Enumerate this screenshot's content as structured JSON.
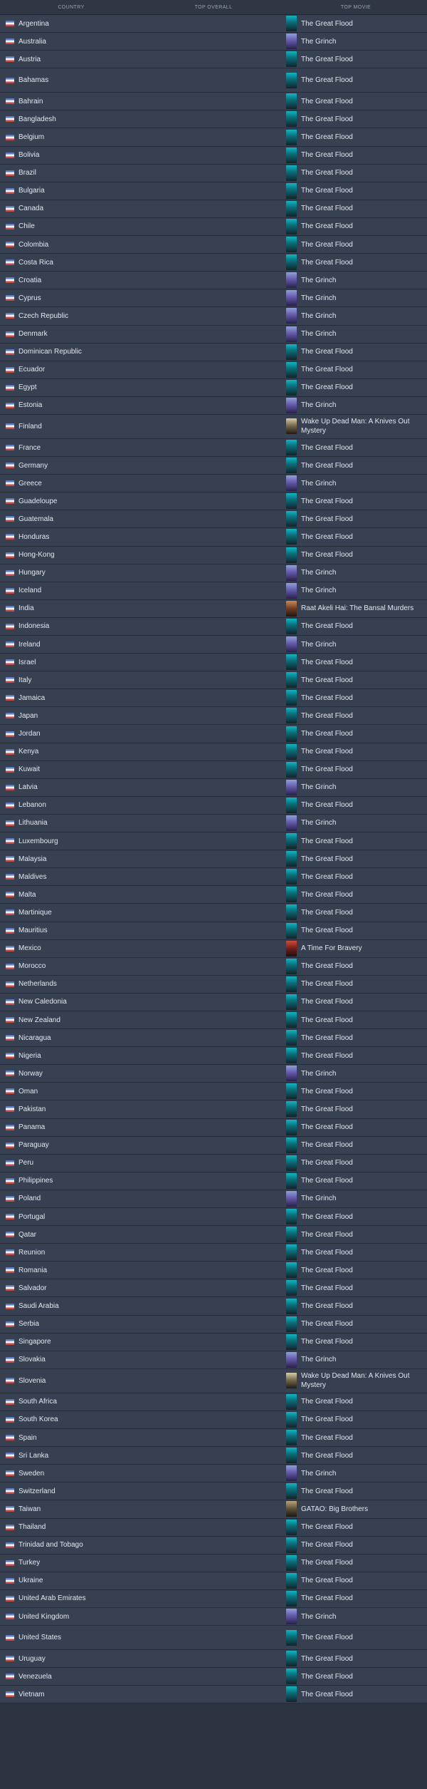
{
  "header": {
    "country": "COUNTRY",
    "overall": "TOP OVERALL",
    "movie": "TOP MOVIE"
  },
  "rows": [
    {
      "country": "Argentina",
      "movie": "The Great Flood",
      "poster": "flood"
    },
    {
      "country": "Australia",
      "movie": "The Grinch",
      "poster": "grinch"
    },
    {
      "country": "Austria",
      "movie": "The Great Flood",
      "poster": "flood"
    },
    {
      "country": "Bahamas",
      "movie": "The Great Flood",
      "poster": "flood",
      "tall": true
    },
    {
      "country": "Bahrain",
      "movie": "The Great Flood",
      "poster": "flood"
    },
    {
      "country": "Bangladesh",
      "movie": "The Great Flood",
      "poster": "flood"
    },
    {
      "country": "Belgium",
      "movie": "The Great Flood",
      "poster": "flood"
    },
    {
      "country": "Bolivia",
      "movie": "The Great Flood",
      "poster": "flood"
    },
    {
      "country": "Brazil",
      "movie": "The Great Flood",
      "poster": "flood"
    },
    {
      "country": "Bulgaria",
      "movie": "The Great Flood",
      "poster": "flood"
    },
    {
      "country": "Canada",
      "movie": "The Great Flood",
      "poster": "flood"
    },
    {
      "country": "Chile",
      "movie": "The Great Flood",
      "poster": "flood"
    },
    {
      "country": "Colombia",
      "movie": "The Great Flood",
      "poster": "flood"
    },
    {
      "country": "Costa Rica",
      "movie": "The Great Flood",
      "poster": "flood"
    },
    {
      "country": "Croatia",
      "movie": "The Grinch",
      "poster": "grinch"
    },
    {
      "country": "Cyprus",
      "movie": "The Grinch",
      "poster": "grinch"
    },
    {
      "country": "Czech Republic",
      "movie": "The Grinch",
      "poster": "grinch"
    },
    {
      "country": "Denmark",
      "movie": "The Grinch",
      "poster": "grinch"
    },
    {
      "country": "Dominican Republic",
      "movie": "The Great Flood",
      "poster": "flood"
    },
    {
      "country": "Ecuador",
      "movie": "The Great Flood",
      "poster": "flood"
    },
    {
      "country": "Egypt",
      "movie": "The Great Flood",
      "poster": "flood"
    },
    {
      "country": "Estonia",
      "movie": "The Grinch",
      "poster": "grinch"
    },
    {
      "country": "Finland",
      "movie": "Wake Up Dead Man: A Knives Out Mystery",
      "poster": "knives",
      "tall": true
    },
    {
      "country": "France",
      "movie": "The Great Flood",
      "poster": "flood"
    },
    {
      "country": "Germany",
      "movie": "The Great Flood",
      "poster": "flood"
    },
    {
      "country": "Greece",
      "movie": "The Grinch",
      "poster": "grinch"
    },
    {
      "country": "Guadeloupe",
      "movie": "The Great Flood",
      "poster": "flood"
    },
    {
      "country": "Guatemala",
      "movie": "The Great Flood",
      "poster": "flood"
    },
    {
      "country": "Honduras",
      "movie": "The Great Flood",
      "poster": "flood"
    },
    {
      "country": "Hong-Kong",
      "movie": "The Great Flood",
      "poster": "flood"
    },
    {
      "country": "Hungary",
      "movie": "The Grinch",
      "poster": "grinch"
    },
    {
      "country": "Iceland",
      "movie": "The Grinch",
      "poster": "grinch"
    },
    {
      "country": "India",
      "movie": "Raat Akeli Hai: The Bansal Murders",
      "poster": "raat"
    },
    {
      "country": "Indonesia",
      "movie": "The Great Flood",
      "poster": "flood"
    },
    {
      "country": "Ireland",
      "movie": "The Grinch",
      "poster": "grinch"
    },
    {
      "country": "Israel",
      "movie": "The Great Flood",
      "poster": "flood"
    },
    {
      "country": "Italy",
      "movie": "The Great Flood",
      "poster": "flood"
    },
    {
      "country": "Jamaica",
      "movie": "The Great Flood",
      "poster": "flood"
    },
    {
      "country": "Japan",
      "movie": "The Great Flood",
      "poster": "flood"
    },
    {
      "country": "Jordan",
      "movie": "The Great Flood",
      "poster": "flood"
    },
    {
      "country": "Kenya",
      "movie": "The Great Flood",
      "poster": "flood"
    },
    {
      "country": "Kuwait",
      "movie": "The Great Flood",
      "poster": "flood"
    },
    {
      "country": "Latvia",
      "movie": "The Grinch",
      "poster": "grinch"
    },
    {
      "country": "Lebanon",
      "movie": "The Great Flood",
      "poster": "flood"
    },
    {
      "country": "Lithuania",
      "movie": "The Grinch",
      "poster": "grinch"
    },
    {
      "country": "Luxembourg",
      "movie": "The Great Flood",
      "poster": "flood"
    },
    {
      "country": "Malaysia",
      "movie": "The Great Flood",
      "poster": "flood"
    },
    {
      "country": "Maldives",
      "movie": "The Great Flood",
      "poster": "flood"
    },
    {
      "country": "Malta",
      "movie": "The Great Flood",
      "poster": "flood"
    },
    {
      "country": "Martinique",
      "movie": "The Great Flood",
      "poster": "flood"
    },
    {
      "country": "Mauritius",
      "movie": "The Great Flood",
      "poster": "flood"
    },
    {
      "country": "Mexico",
      "movie": "A Time For Bravery",
      "poster": "bravery"
    },
    {
      "country": "Morocco",
      "movie": "The Great Flood",
      "poster": "flood"
    },
    {
      "country": "Netherlands",
      "movie": "The Great Flood",
      "poster": "flood"
    },
    {
      "country": "New Caledonia",
      "movie": "The Great Flood",
      "poster": "flood"
    },
    {
      "country": "New Zealand",
      "movie": "The Great Flood",
      "poster": "flood"
    },
    {
      "country": "Nicaragua",
      "movie": "The Great Flood",
      "poster": "flood"
    },
    {
      "country": "Nigeria",
      "movie": "The Great Flood",
      "poster": "flood"
    },
    {
      "country": "Norway",
      "movie": "The Grinch",
      "poster": "grinch"
    },
    {
      "country": "Oman",
      "movie": "The Great Flood",
      "poster": "flood"
    },
    {
      "country": "Pakistan",
      "movie": "The Great Flood",
      "poster": "flood"
    },
    {
      "country": "Panama",
      "movie": "The Great Flood",
      "poster": "flood"
    },
    {
      "country": "Paraguay",
      "movie": "The Great Flood",
      "poster": "flood"
    },
    {
      "country": "Peru",
      "movie": "The Great Flood",
      "poster": "flood"
    },
    {
      "country": "Philippines",
      "movie": "The Great Flood",
      "poster": "flood"
    },
    {
      "country": "Poland",
      "movie": "The Grinch",
      "poster": "grinch"
    },
    {
      "country": "Portugal",
      "movie": "The Great Flood",
      "poster": "flood"
    },
    {
      "country": "Qatar",
      "movie": "The Great Flood",
      "poster": "flood"
    },
    {
      "country": "Reunion",
      "movie": "The Great Flood",
      "poster": "flood"
    },
    {
      "country": "Romania",
      "movie": "The Great Flood",
      "poster": "flood"
    },
    {
      "country": "Salvador",
      "movie": "The Great Flood",
      "poster": "flood"
    },
    {
      "country": "Saudi Arabia",
      "movie": "The Great Flood",
      "poster": "flood"
    },
    {
      "country": "Serbia",
      "movie": "The Great Flood",
      "poster": "flood"
    },
    {
      "country": "Singapore",
      "movie": "The Great Flood",
      "poster": "flood"
    },
    {
      "country": "Slovakia",
      "movie": "The Grinch",
      "poster": "grinch"
    },
    {
      "country": "Slovenia",
      "movie": "Wake Up Dead Man: A Knives Out Mystery",
      "poster": "knives",
      "tall": true
    },
    {
      "country": "South Africa",
      "movie": "The Great Flood",
      "poster": "flood"
    },
    {
      "country": "South Korea",
      "movie": "The Great Flood",
      "poster": "flood"
    },
    {
      "country": "Spain",
      "movie": "The Great Flood",
      "poster": "flood"
    },
    {
      "country": "Sri Lanka",
      "movie": "The Great Flood",
      "poster": "flood"
    },
    {
      "country": "Sweden",
      "movie": "The Grinch",
      "poster": "grinch"
    },
    {
      "country": "Switzerland",
      "movie": "The Great Flood",
      "poster": "flood"
    },
    {
      "country": "Taiwan",
      "movie": "GATAO: Big Brothers",
      "poster": "gatao"
    },
    {
      "country": "Thailand",
      "movie": "The Great Flood",
      "poster": "flood"
    },
    {
      "country": "Trinidad and Tobago",
      "movie": "The Great Flood",
      "poster": "flood"
    },
    {
      "country": "Turkey",
      "movie": "The Great Flood",
      "poster": "flood"
    },
    {
      "country": "Ukraine",
      "movie": "The Great Flood",
      "poster": "flood"
    },
    {
      "country": "United Arab Emirates",
      "movie": "The Great Flood",
      "poster": "flood"
    },
    {
      "country": "United Kingdom",
      "movie": "The Grinch",
      "poster": "grinch"
    },
    {
      "country": "United States",
      "movie": "The Great Flood",
      "poster": "flood",
      "tall": true
    },
    {
      "country": "Uruguay",
      "movie": "The Great Flood",
      "poster": "flood"
    },
    {
      "country": "Venezuela",
      "movie": "The Great Flood",
      "poster": "flood"
    },
    {
      "country": "Vietnam",
      "movie": "The Great Flood",
      "poster": "flood"
    }
  ]
}
